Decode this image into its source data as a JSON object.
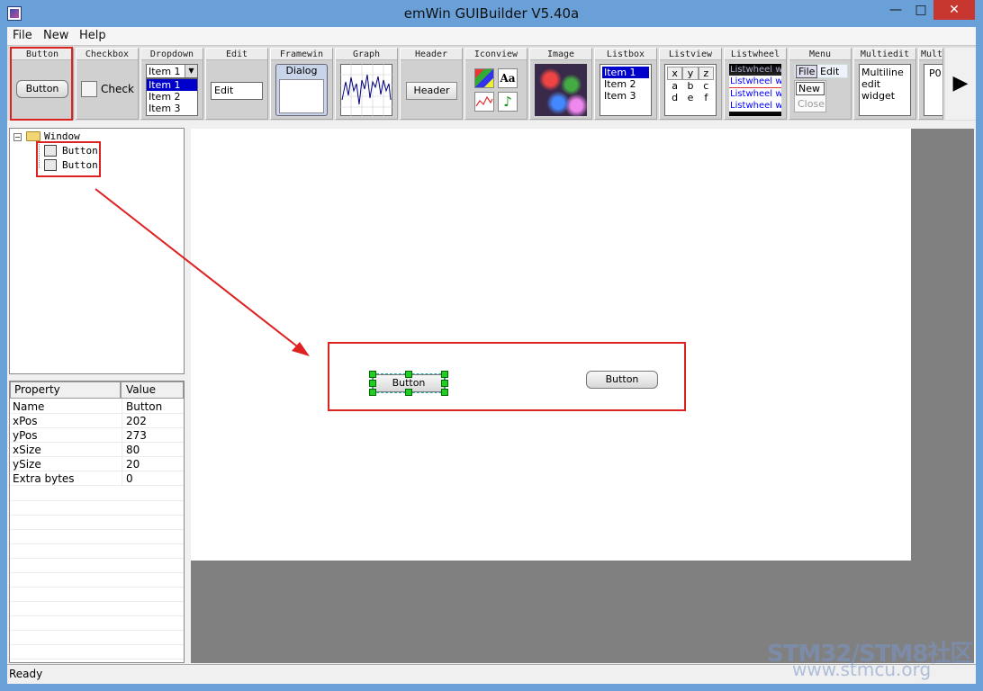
{
  "window": {
    "title": "emWin GUIBuilder V5.40a",
    "minimize": "—",
    "maximize": "□",
    "close": "✕"
  },
  "menu": [
    "File",
    "New",
    "Help"
  ],
  "toolbar": {
    "button": {
      "header": "Button",
      "label": "Button"
    },
    "checkbox": {
      "header": "Checkbox",
      "label": "Check"
    },
    "dropdown": {
      "header": "Dropdown",
      "selected": "Item 1",
      "items": [
        "Item 1",
        "Item 2",
        "Item 3"
      ]
    },
    "edit": {
      "header": "Edit",
      "value": "Edit"
    },
    "framewin": {
      "header": "Framewin",
      "caption": "Dialog"
    },
    "graph": {
      "header": "Graph"
    },
    "header": {
      "header": "Header",
      "label": "Header"
    },
    "iconview": {
      "header": "Iconview",
      "text_icon": "Aa"
    },
    "image": {
      "header": "Image"
    },
    "listbox": {
      "header": "Listbox",
      "items": [
        "Item 1",
        "Item 2",
        "Item 3"
      ]
    },
    "listview": {
      "header": "Listview",
      "rows": [
        [
          "x",
          "y",
          "z"
        ],
        [
          "a",
          "b",
          "c"
        ],
        [
          "d",
          "e",
          "f"
        ]
      ]
    },
    "listwheel": {
      "header": "Listwheel",
      "items": [
        "Listwheel wid",
        "Listwheel wid",
        "Listwheel wid",
        "Listwheel wid"
      ]
    },
    "menu": {
      "header": "Menu",
      "items": [
        "File",
        "Edit"
      ],
      "submenu": [
        "New",
        "Close"
      ]
    },
    "multiedit": {
      "header": "Multiedit",
      "lines": [
        "Multiline",
        "edit",
        "widget"
      ]
    },
    "multipage": {
      "header": "Mult",
      "label": "P0"
    },
    "scroll_right": "▶"
  },
  "tree": {
    "root": "Window",
    "children": [
      "Button",
      "Button"
    ],
    "expander": "−"
  },
  "properties": {
    "col_property": "Property",
    "col_value": "Value",
    "rows": [
      [
        "Name",
        "Button"
      ],
      [
        "xPos",
        "202"
      ],
      [
        "yPos",
        "273"
      ],
      [
        "xSize",
        "80"
      ],
      [
        "ySize",
        "20"
      ],
      [
        "Extra bytes",
        "0"
      ]
    ]
  },
  "canvas": {
    "button_selected": "Button",
    "button_other": "Button"
  },
  "status": "Ready",
  "watermark": {
    "line1": "STM32/STM8社区",
    "line2": "www.stmcu.org"
  },
  "colors": {
    "annotation": "#dd2222",
    "handle": "#22cc22",
    "selection": "#0000cc"
  }
}
